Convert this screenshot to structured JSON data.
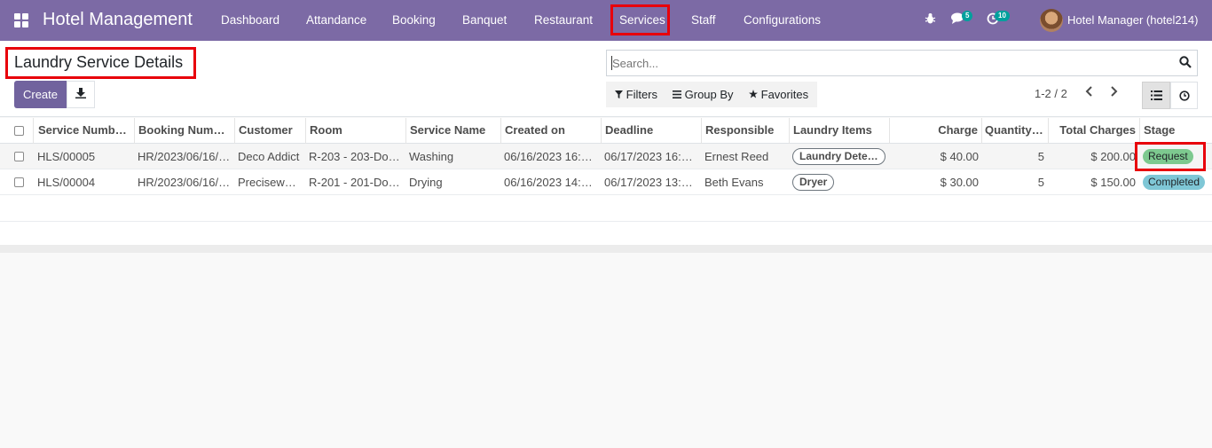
{
  "navbar": {
    "brand": "Hotel Management",
    "menu": [
      "Dashboard",
      "Attandance",
      "Booking",
      "Banquet",
      "Restaurant",
      "Services",
      "Staff",
      "Configurations"
    ],
    "active_menu": "Services",
    "messages_count": "5",
    "activities_count": "10",
    "user": "Hotel Manager (hotel214)",
    "accent_color": "#7c6aa5"
  },
  "control_panel": {
    "title": "Laundry Service Details",
    "create_label": "Create",
    "search_placeholder": "Search...",
    "filters_label": "Filters",
    "group_by_label": "Group By",
    "favorites_label": "Favorites",
    "pager": "1-2 / 2"
  },
  "table": {
    "columns": [
      "Service Numb…",
      "Booking Num…",
      "Customer",
      "Room",
      "Service Name",
      "Created on",
      "Deadline",
      "Responsible",
      "Laundry Items",
      "Charge",
      "Quantity…",
      "Total Charges",
      "Stage"
    ],
    "rows": [
      {
        "service_number": "HLS/00005",
        "booking_number": "HR/2023/06/16/…",
        "customer": "Deco Addict",
        "room": "R-203 - 203-Do…",
        "service_name": "Washing",
        "created_on": "06/16/2023 16:…",
        "deadline": "06/17/2023 16:…",
        "responsible": "Ernest Reed",
        "laundry_items": "Laundry Dete…",
        "charge": "$ 40.00",
        "quantity": "5",
        "total_charges": "$ 200.00",
        "stage": "Request"
      },
      {
        "service_number": "HLS/00004",
        "booking_number": "HR/2023/06/16/…",
        "customer": "Precisew…",
        "room": "R-201 - 201-Do…",
        "service_name": "Drying",
        "created_on": "06/16/2023 14:…",
        "deadline": "06/17/2023 13:…",
        "responsible": "Beth Evans",
        "laundry_items": "Dryer",
        "charge": "$ 30.00",
        "quantity": "5",
        "total_charges": "$ 150.00",
        "stage": "Completed"
      }
    ]
  }
}
